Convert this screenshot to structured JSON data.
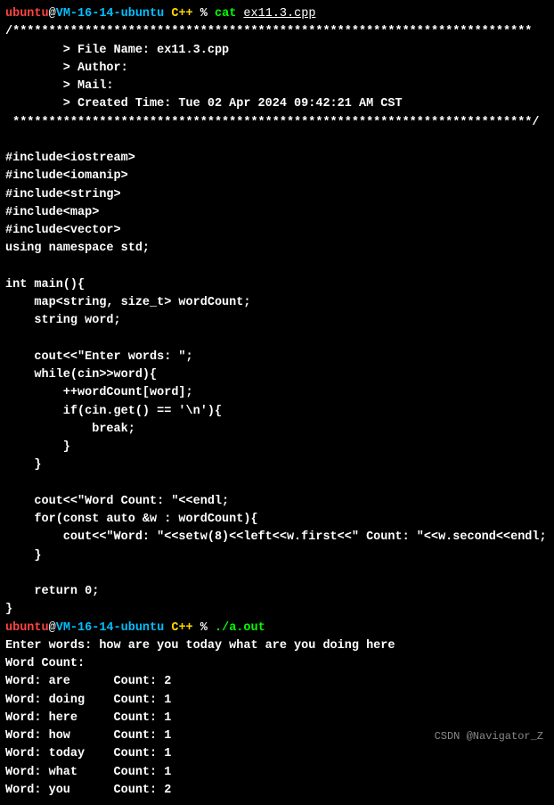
{
  "prompt1": {
    "user": "ubuntu",
    "at": "@",
    "host": "VM-16-14-ubuntu",
    "dir": "C++",
    "pct": "%",
    "cmd": "cat",
    "arg": "ex11.3.cpp"
  },
  "header": {
    "top": "/************************************************************************",
    "file": "        > File Name: ex11.3.cpp",
    "author": "        > Author: ",
    "mail": "        > Mail: ",
    "created": "        > Created Time: Tue 02 Apr 2024 09:42:21 AM CST",
    "bot": " ************************************************************************/"
  },
  "code": [
    "",
    "#include<iostream>",
    "#include<iomanip>",
    "#include<string>",
    "#include<map>",
    "#include<vector>",
    "using namespace std;",
    "",
    "int main(){",
    "    map<string, size_t> wordCount;",
    "    string word;",
    "",
    "    cout<<\"Enter words: \";",
    "    while(cin>>word){",
    "        ++wordCount[word];",
    "        if(cin.get() == '\\n'){",
    "            break;",
    "        }",
    "    }",
    "",
    "    cout<<\"Word Count: \"<<endl;",
    "    for(const auto &w : wordCount){",
    "        cout<<\"Word: \"<<setw(8)<<left<<w.first<<\" Count: \"<<w.second<<endl;",
    "    }",
    "",
    "    return 0;",
    "}"
  ],
  "prompt2": {
    "user": "ubuntu",
    "at": "@",
    "host": "VM-16-14-ubuntu",
    "dir": "C++",
    "pct": "%",
    "cmd": "./a.out"
  },
  "run_output": [
    "Enter words: how are you today what are you doing here",
    "Word Count: ",
    "Word: are      Count: 2",
    "Word: doing    Count: 1",
    "Word: here     Count: 1",
    "Word: how      Count: 1",
    "Word: today    Count: 1",
    "Word: what     Count: 1",
    "Word: you      Count: 2"
  ],
  "watermark": "CSDN @Navigator_Z"
}
